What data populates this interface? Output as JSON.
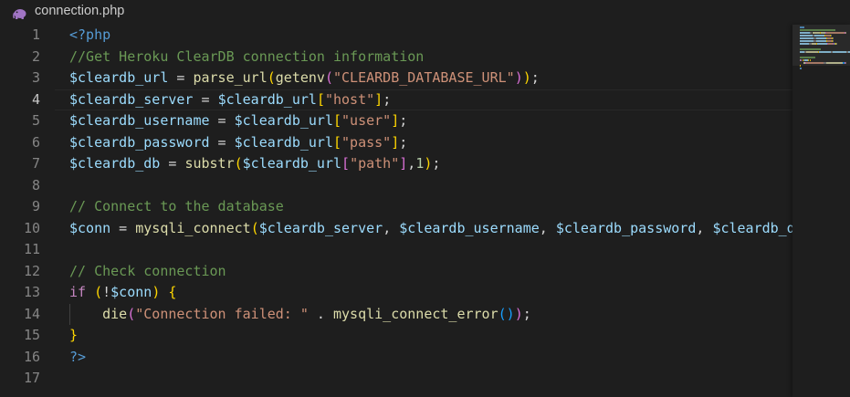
{
  "tab": {
    "filename": "connection.php",
    "icon": "php-elephant-icon"
  },
  "colors": {
    "background": "#1e1e1e",
    "tag": "#569cd6",
    "comment": "#6a9955",
    "variable": "#9cdcfe",
    "function": "#dcdcaa",
    "string": "#ce9178",
    "number": "#b5cea8",
    "keyword": "#c586c0",
    "bracket1": "#ffd700",
    "bracket2": "#da70d6",
    "bracket3": "#179fff"
  },
  "editor": {
    "active_line": 4,
    "line_numbers": [
      "1",
      "2",
      "3",
      "4",
      "5",
      "6",
      "7",
      "8",
      "9",
      "10",
      "11",
      "12",
      "13",
      "14",
      "15",
      "16",
      "17"
    ],
    "lines": [
      [
        [
          "tag",
          "<?php"
        ]
      ],
      [
        [
          "com",
          "//Get Heroku ClearDB connection information"
        ]
      ],
      [
        [
          "var",
          "$cleardb_url"
        ],
        [
          "op",
          " = "
        ],
        [
          "fn",
          "parse_url"
        ],
        [
          "p1",
          "("
        ],
        [
          "fn",
          "getenv"
        ],
        [
          "p2",
          "("
        ],
        [
          "str",
          "\"CLEARDB_DATABASE_URL\""
        ],
        [
          "p2",
          ")"
        ],
        [
          "p1",
          ")"
        ],
        [
          "op",
          ";"
        ]
      ],
      [
        [
          "var",
          "$cleardb_server"
        ],
        [
          "op",
          " = "
        ],
        [
          "var",
          "$cleardb_url"
        ],
        [
          "p1",
          "["
        ],
        [
          "str",
          "\"host\""
        ],
        [
          "p1",
          "]"
        ],
        [
          "op",
          ";"
        ]
      ],
      [
        [
          "var",
          "$cleardb_username"
        ],
        [
          "op",
          " = "
        ],
        [
          "var",
          "$cleardb_url"
        ],
        [
          "p1",
          "["
        ],
        [
          "str",
          "\"user\""
        ],
        [
          "p1",
          "]"
        ],
        [
          "op",
          ";"
        ]
      ],
      [
        [
          "var",
          "$cleardb_password"
        ],
        [
          "op",
          " = "
        ],
        [
          "var",
          "$cleardb_url"
        ],
        [
          "p1",
          "["
        ],
        [
          "str",
          "\"pass\""
        ],
        [
          "p1",
          "]"
        ],
        [
          "op",
          ";"
        ]
      ],
      [
        [
          "var",
          "$cleardb_db"
        ],
        [
          "op",
          " = "
        ],
        [
          "fn",
          "substr"
        ],
        [
          "p1",
          "("
        ],
        [
          "var",
          "$cleardb_url"
        ],
        [
          "p2",
          "["
        ],
        [
          "str",
          "\"path\""
        ],
        [
          "p2",
          "]"
        ],
        [
          "op",
          ","
        ],
        [
          "num",
          "1"
        ],
        [
          "p1",
          ")"
        ],
        [
          "op",
          ";"
        ]
      ],
      [],
      [
        [
          "com",
          "// Connect to the database"
        ]
      ],
      [
        [
          "var",
          "$conn"
        ],
        [
          "op",
          " = "
        ],
        [
          "fn",
          "mysqli_connect"
        ],
        [
          "p1",
          "("
        ],
        [
          "var",
          "$cleardb_server"
        ],
        [
          "op",
          ", "
        ],
        [
          "var",
          "$cleardb_username"
        ],
        [
          "op",
          ", "
        ],
        [
          "var",
          "$cleardb_password"
        ],
        [
          "op",
          ", "
        ],
        [
          "var",
          "$cleardb_db"
        ],
        [
          "p1",
          ")"
        ],
        [
          "op",
          ";"
        ]
      ],
      [],
      [
        [
          "com",
          "// Check connection"
        ]
      ],
      [
        [
          "kw",
          "if"
        ],
        [
          "op",
          " "
        ],
        [
          "p1",
          "("
        ],
        [
          "op",
          "!"
        ],
        [
          "var",
          "$conn"
        ],
        [
          "p1",
          ")"
        ],
        [
          "op",
          " "
        ],
        [
          "p1",
          "{"
        ]
      ],
      [
        [
          "op",
          "    "
        ],
        [
          "fn",
          "die"
        ],
        [
          "p2",
          "("
        ],
        [
          "str",
          "\"Connection failed: \""
        ],
        [
          "op",
          " . "
        ],
        [
          "fn",
          "mysqli_connect_error"
        ],
        [
          "p3",
          "()"
        ],
        [
          "p2",
          ")"
        ],
        [
          "op",
          ";"
        ]
      ],
      [
        [
          "p1",
          "}"
        ]
      ],
      [
        [
          "tag",
          "?>"
        ]
      ],
      []
    ]
  }
}
